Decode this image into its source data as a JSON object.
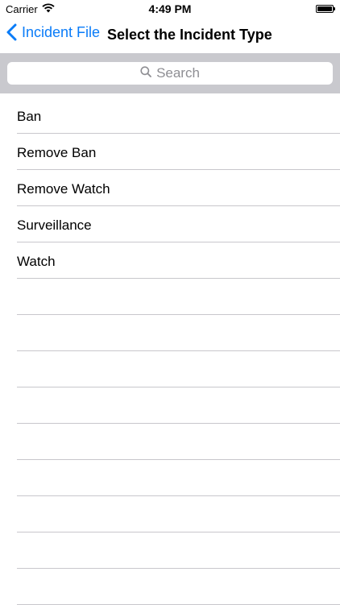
{
  "status_bar": {
    "carrier": "Carrier",
    "time": "4:49 PM"
  },
  "nav": {
    "back_label": "Incident File",
    "title": "Select the Incident Type"
  },
  "search": {
    "placeholder": "Search"
  },
  "list": {
    "items": [
      {
        "label": "Ban"
      },
      {
        "label": "Remove Ban"
      },
      {
        "label": "Remove Watch"
      },
      {
        "label": "Surveillance"
      },
      {
        "label": "Watch"
      }
    ],
    "empty_rows": 9
  },
  "colors": {
    "accent": "#0a7cf8",
    "search_bar_bg": "#c9c9ce",
    "separator": "#c8c7cc"
  },
  "icons": [
    "wifi-icon",
    "battery-icon",
    "chevron-left-icon",
    "search-icon"
  ]
}
